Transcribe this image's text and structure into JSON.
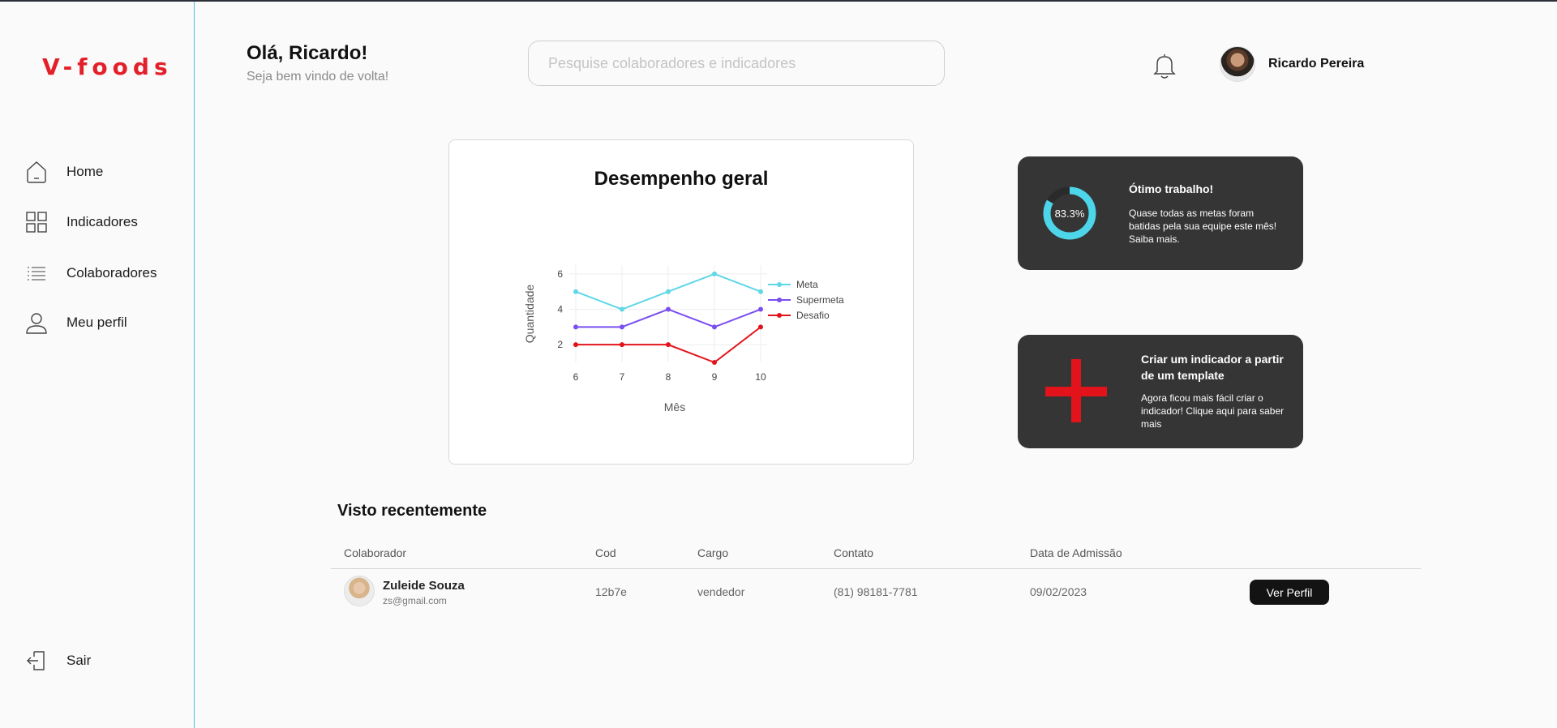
{
  "brand": {
    "logo": "V-foods",
    "accent": "#e3202a",
    "sidebar_border": "#49c6d8"
  },
  "sidebar": {
    "items": [
      {
        "label": "Home",
        "icon": "home-icon"
      },
      {
        "label": "Indicadores",
        "icon": "grid-icon"
      },
      {
        "label": "Colaboradores",
        "icon": "list-icon"
      },
      {
        "label": "Meu perfil",
        "icon": "user-icon"
      }
    ],
    "logout": {
      "label": "Sair",
      "icon": "logout-icon"
    }
  },
  "header": {
    "greeting": "Olá, Ricardo!",
    "subtitle": "Seja bem vindo de volta!",
    "search_placeholder": "Pesquise colaboradores e indicadores",
    "user_name": "Ricardo Pereira",
    "notification_icon": "bell-icon"
  },
  "chart_data": {
    "type": "line",
    "title": "Desempenho geral",
    "xlabel": "Mês",
    "ylabel": "Quantidade",
    "x": [
      6,
      7,
      8,
      9,
      10
    ],
    "ylim": [
      1,
      6.5
    ],
    "yticks": [
      2,
      4,
      6
    ],
    "grid": true,
    "legend_position": "right",
    "series": [
      {
        "name": "Meta",
        "values": [
          5,
          4,
          5,
          6,
          5
        ],
        "color": "#5fd7e6"
      },
      {
        "name": "Supermeta",
        "values": [
          3,
          3,
          4,
          3,
          4
        ],
        "color": "#7b4ff0"
      },
      {
        "name": "Desafio",
        "values": [
          2,
          2,
          2,
          1,
          3
        ],
        "color": "#e3131b"
      }
    ]
  },
  "cards": {
    "performance": {
      "percent_label": "83.3%",
      "percent_value": 83.3,
      "ring_color": "#4dd5ea",
      "title": "Ótimo trabalho!",
      "text": "Quase todas as metas foram batidas pela sua equipe este mês! Saiba mais."
    },
    "template": {
      "icon": "plus-icon",
      "icon_color": "#e3131b",
      "title": "Criar um indicador a partir de um template",
      "text": "Agora ficou mais fácil criar o indicador! Clique aqui para saber mais"
    }
  },
  "recent": {
    "title": "Visto recentemente",
    "columns": [
      "Colaborador",
      "Cod",
      "Cargo",
      "Contato",
      "Data de Admissão"
    ],
    "rows": [
      {
        "name": "Zuleide Souza",
        "email": "zs@gmail.com",
        "cod": "12b7e",
        "cargo": "vendedor",
        "contato": "(81) 98181-7781",
        "admissao": "09/02/2023",
        "action": "Ver Perfil"
      }
    ]
  }
}
